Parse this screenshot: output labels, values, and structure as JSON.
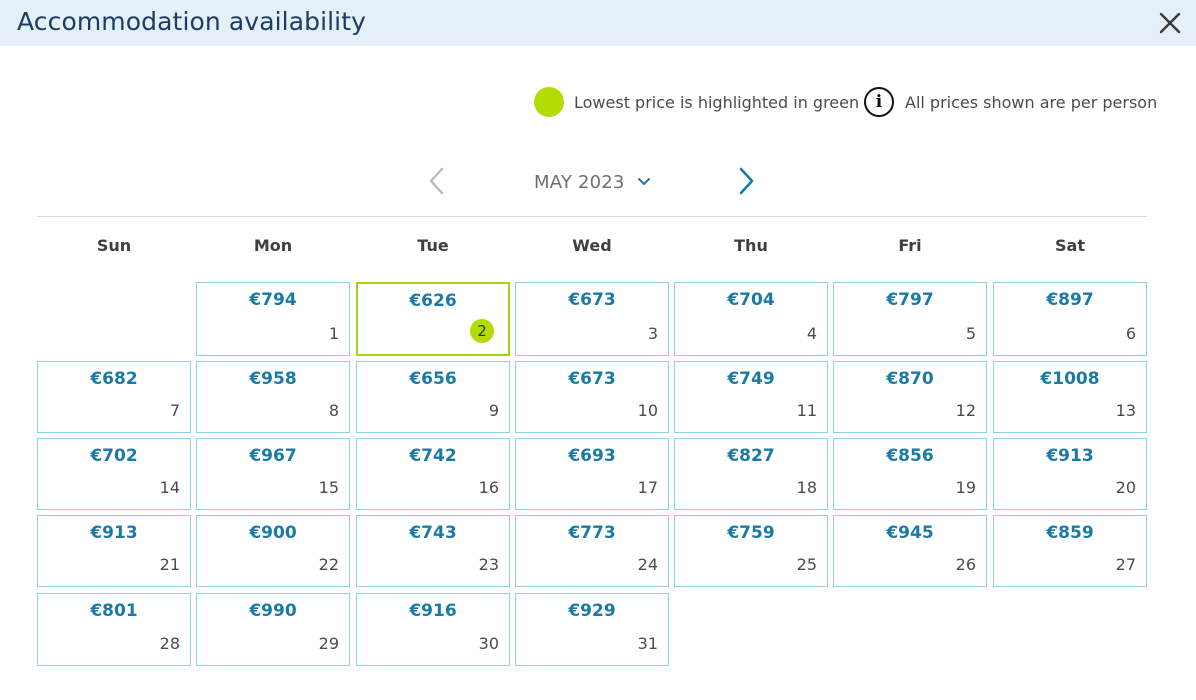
{
  "dialog": {
    "title": "Accommodation availability",
    "close_icon": "close-icon"
  },
  "legend": {
    "lowest_label": "Lowest price is highlighted in green",
    "lowest_color": "#b2dc02",
    "info_icon": "info-icon",
    "info_glyph": "i",
    "per_person_label": "All prices shown are per person"
  },
  "month_nav": {
    "prev_icon": "chevron-left-icon",
    "next_icon": "chevron-right-icon",
    "current_month": "MAY 2023",
    "dropdown_icon": "chevron-down-icon"
  },
  "weekdays": [
    "Sun",
    "Mon",
    "Tue",
    "Wed",
    "Thu",
    "Fri",
    "Sat"
  ],
  "colors": {
    "price": "#1b7aa3",
    "cell_border": "#90d1e2",
    "lowest_border": "#a6d11a",
    "header_bg": "#e3f0f8",
    "title": "#1d3b63"
  },
  "calendar": {
    "first_weekday_index": 1,
    "days": [
      {
        "day": "1",
        "price": "€794"
      },
      {
        "day": "2",
        "price": "€626",
        "lowest": true
      },
      {
        "day": "3",
        "price": "€673"
      },
      {
        "day": "4",
        "price": "€704"
      },
      {
        "day": "5",
        "price": "€797"
      },
      {
        "day": "6",
        "price": "€897"
      },
      {
        "day": "7",
        "price": "€682"
      },
      {
        "day": "8",
        "price": "€958"
      },
      {
        "day": "9",
        "price": "€656"
      },
      {
        "day": "10",
        "price": "€673"
      },
      {
        "day": "11",
        "price": "€749"
      },
      {
        "day": "12",
        "price": "€870"
      },
      {
        "day": "13",
        "price": "€1008"
      },
      {
        "day": "14",
        "price": "€702"
      },
      {
        "day": "15",
        "price": "€967"
      },
      {
        "day": "16",
        "price": "€742"
      },
      {
        "day": "17",
        "price": "€693"
      },
      {
        "day": "18",
        "price": "€827"
      },
      {
        "day": "19",
        "price": "€856"
      },
      {
        "day": "20",
        "price": "€913"
      },
      {
        "day": "21",
        "price": "€913"
      },
      {
        "day": "22",
        "price": "€900"
      },
      {
        "day": "23",
        "price": "€743"
      },
      {
        "day": "24",
        "price": "€773"
      },
      {
        "day": "25",
        "price": "€759"
      },
      {
        "day": "26",
        "price": "€945"
      },
      {
        "day": "27",
        "price": "€859"
      },
      {
        "day": "28",
        "price": "€801"
      },
      {
        "day": "29",
        "price": "€990"
      },
      {
        "day": "30",
        "price": "€916"
      },
      {
        "day": "31",
        "price": "€929"
      }
    ]
  }
}
